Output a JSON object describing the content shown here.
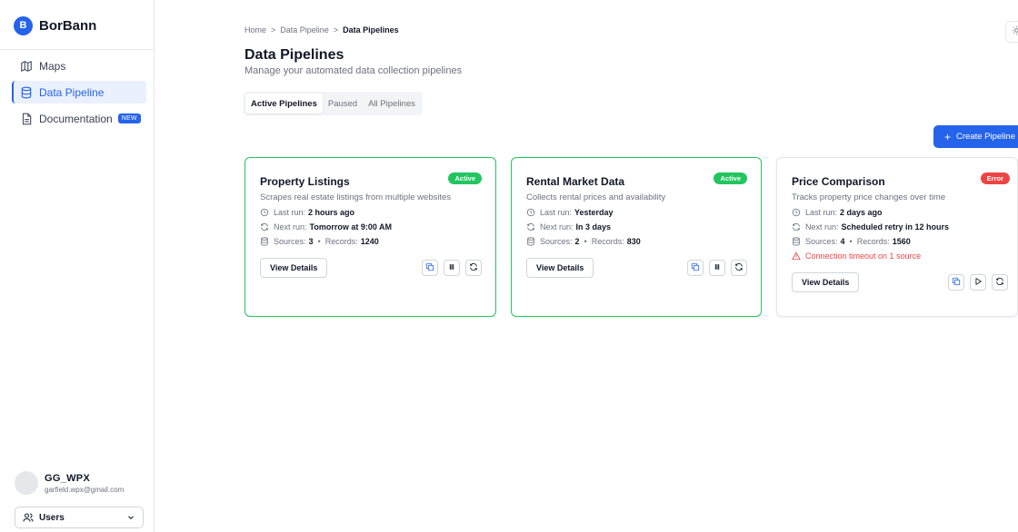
{
  "brand": {
    "logo_letter": "B",
    "name": "BorBann"
  },
  "sidebar": {
    "items": [
      {
        "label": "Maps",
        "icon": "map-icon",
        "active": false
      },
      {
        "label": "Data Pipeline",
        "icon": "database-icon",
        "active": true
      },
      {
        "label": "Documentation",
        "icon": "document-icon",
        "active": false,
        "badge": "NEW"
      }
    ]
  },
  "user": {
    "name": "GG_WPX",
    "email": "garfield.wpx@gmail.com"
  },
  "users_select": {
    "label": "Users"
  },
  "breadcrumb": {
    "items": [
      "Home",
      "Data Pipeline"
    ],
    "current": "Data Pipelines",
    "separator": ">"
  },
  "page": {
    "title": "Data Pipelines",
    "subtitle": "Manage your automated data collection pipelines"
  },
  "tabs": [
    {
      "label": "Active Pipelines",
      "active": true
    },
    {
      "label": "Paused",
      "active": false
    },
    {
      "label": "All Pipelines",
      "active": false
    }
  ],
  "create_button": {
    "label": "Create Pipeline"
  },
  "labels": {
    "last_run": "Last run:",
    "next_run": "Next run:",
    "sources": "Sources:",
    "records": "Records:",
    "view_details": "View Details"
  },
  "cards": [
    {
      "title": "Property Listings",
      "status": "Active",
      "description": "Scrapes real estate listings from multiple websites",
      "last_run": "2 hours ago",
      "next_run": "Tomorrow at 9:00 AM",
      "sources": "3",
      "records": "1240"
    },
    {
      "title": "Rental Market Data",
      "status": "Active",
      "description": "Collects rental prices and availability",
      "last_run": "Yesterday",
      "next_run": "In 3 days",
      "sources": "2",
      "records": "830"
    },
    {
      "title": "Price Comparison",
      "status": "Error",
      "description": "Tracks property price changes over time",
      "last_run": "2 days ago",
      "next_run": "Scheduled retry in 12 hours",
      "sources": "4",
      "records": "1560",
      "error": "Connection timeout on 1 source"
    }
  ],
  "colors": {
    "accent": "#2563eb",
    "active": "#22c55e",
    "error": "#ef4444"
  }
}
